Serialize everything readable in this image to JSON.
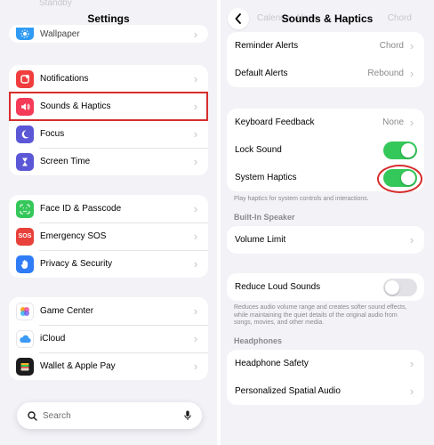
{
  "left": {
    "title": "Settings",
    "ghost_top": "Standby",
    "partial_item": {
      "label": "Wallpaper",
      "icon": "wallpaper-icon",
      "color": "#2f9bf5"
    },
    "groups": [
      [
        {
          "label": "Notifications",
          "icon": "notifications-icon",
          "color": "#f03d3d"
        },
        {
          "label": "Sounds & Haptics",
          "icon": "sounds-haptics-icon",
          "color": "#f53b57"
        },
        {
          "label": "Focus",
          "icon": "focus-moon-icon",
          "color": "#5b57d6"
        },
        {
          "label": "Screen Time",
          "icon": "screen-time-icon",
          "color": "#5b57d6"
        }
      ],
      [
        {
          "label": "Face ID & Passcode",
          "icon": "face-id-icon",
          "color": "#34c759"
        },
        {
          "label": "Emergency SOS",
          "icon": "emergency-sos-icon",
          "color": "#e8403a"
        },
        {
          "label": "Privacy & Security",
          "icon": "privacy-hand-icon",
          "color": "#2f7cf6"
        }
      ],
      [
        {
          "label": "Game Center",
          "icon": "game-center-icon",
          "color": "#ffffff"
        },
        {
          "label": "iCloud",
          "icon": "icloud-icon",
          "color": "#ffffff"
        },
        {
          "label": "Wallet & Apple Pay",
          "icon": "wallet-icon",
          "color": "#1c1c1e"
        }
      ]
    ],
    "search_placeholder": "Search"
  },
  "right": {
    "title": "Sounds & Haptics",
    "ghost_left": "Calendar Alerts",
    "ghost_right": "Chord",
    "group1": [
      {
        "label": "Reminder Alerts",
        "value": "Chord"
      },
      {
        "label": "Default Alerts",
        "value": "Rebound"
      }
    ],
    "keyboard_feedback": {
      "label": "Keyboard Feedback",
      "value": "None"
    },
    "lock_sound": {
      "label": "Lock Sound",
      "on": true
    },
    "system_haptics": {
      "label": "System Haptics",
      "on": true
    },
    "haptics_note": "Play haptics for system controls and interactions.",
    "builtin_speaker_header": "Built-In Speaker",
    "volume_limit": "Volume Limit",
    "reduce_loud": {
      "label": "Reduce Loud Sounds",
      "on": false
    },
    "reduce_note": "Reduces audio volume range and creates softer sound effects, while maintaining the quiet details of the original audio from songs, movies, and other media.",
    "headphones_header": "Headphones",
    "headphone_safety": "Headphone Safety",
    "spatial_audio": "Personalized Spatial Audio"
  },
  "colors": {
    "toggle_on": "#34c759",
    "toggle_off": "#e2e2e6",
    "highlight": "#d62e2e"
  }
}
